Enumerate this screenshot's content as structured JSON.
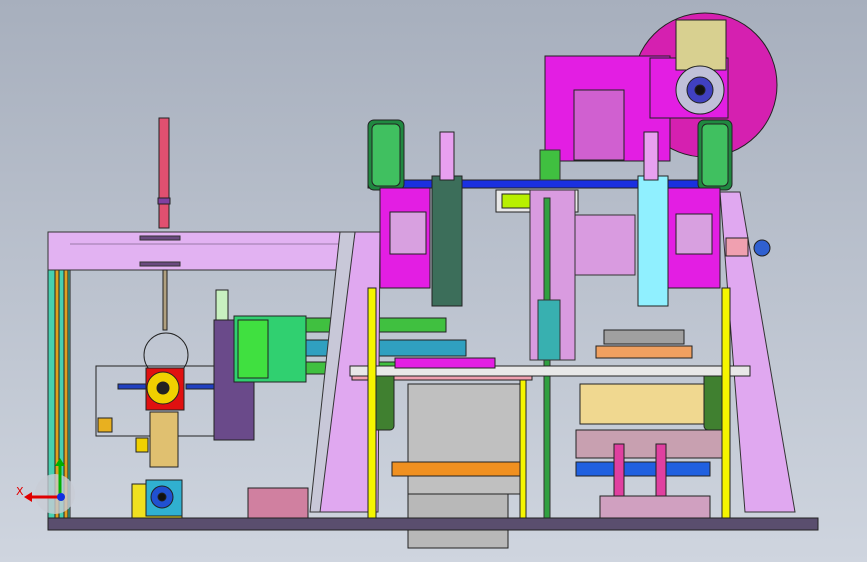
{
  "viewport": {
    "background_top": "#a7afbd",
    "background_bottom": "#cfd5df"
  },
  "triad": {
    "x_label": "X",
    "x_color": "#e00000",
    "y_color": "#00b000",
    "z_color": "#1030e0"
  },
  "palette": {
    "magenta": "#e31ee3",
    "lavender": "#e2a8f2",
    "violet": "#d99be0",
    "green": "#28b838",
    "lime": "#b8f000",
    "blue": "#1e32e0",
    "teal": "#20b0a0",
    "cyan": "#90f0ff",
    "orange": "#f09020",
    "yellow": "#f5f500",
    "red": "#e02020",
    "pink": "#f080c0",
    "olive": "#808040",
    "grey": "#8a8a8a",
    "dark_teal": "#3c6e5a",
    "base": "#5a4e6e"
  }
}
